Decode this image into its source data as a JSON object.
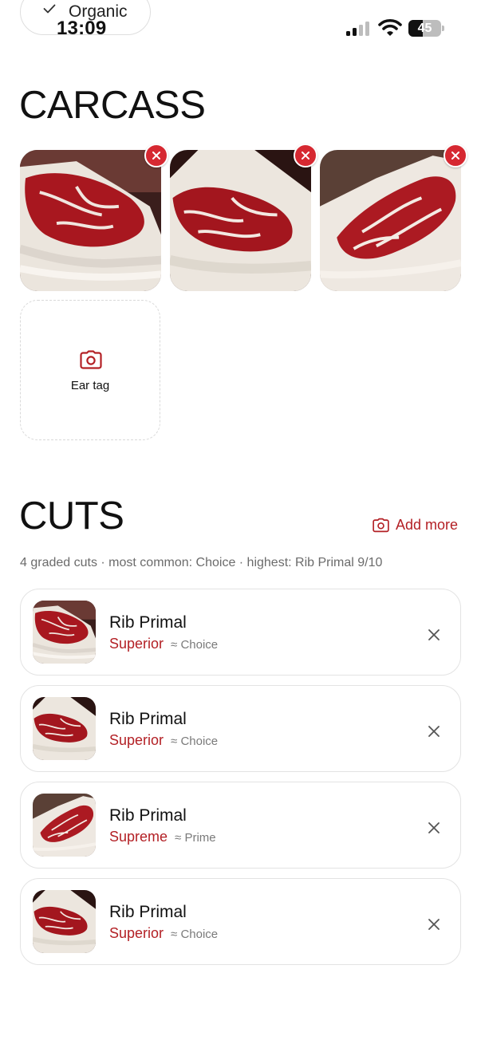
{
  "status_bar": {
    "time": "13:09",
    "battery_percent": "45",
    "battery_level": 0.45,
    "chip_label": "Organic",
    "icons": [
      "checkmark-icon",
      "cellular-signal-icon",
      "wifi-icon",
      "battery-icon"
    ]
  },
  "carcass": {
    "title": "CARCASS",
    "photos": [
      {
        "name": "carcass-photo-1",
        "remove_icon": "close-icon"
      },
      {
        "name": "carcass-photo-2",
        "remove_icon": "close-icon"
      },
      {
        "name": "carcass-photo-3",
        "remove_icon": "close-icon"
      }
    ],
    "ear_tag": {
      "label": "Ear tag",
      "icon": "camera-icon"
    }
  },
  "cuts": {
    "title": "CUTS",
    "add_more_label": "Add more",
    "add_more_icon": "camera-icon",
    "summary": "4 graded cuts · most common: Choice · highest: Rib Primal 9/10",
    "items": [
      {
        "name": "Rib Primal",
        "grade": "Superior",
        "approx": "≈ Choice"
      },
      {
        "name": "Rib Primal",
        "grade": "Superior",
        "approx": "≈ Choice"
      },
      {
        "name": "Rib Primal",
        "grade": "Supreme",
        "approx": "≈ Prime"
      },
      {
        "name": "Rib Primal",
        "grade": "Superior",
        "approx": "≈ Choice"
      }
    ]
  },
  "colors": {
    "accent": "#b32025",
    "remove_badge": "#d62831",
    "meat": "#a31820",
    "fat": "#efe9e2"
  }
}
